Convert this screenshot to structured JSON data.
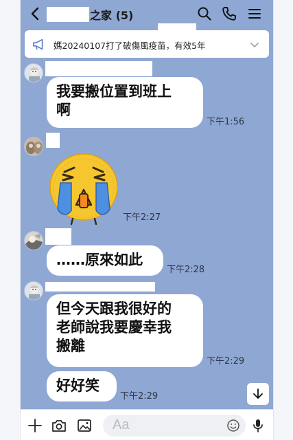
{
  "header": {
    "title_suffix": "之家",
    "member_count": "(5)"
  },
  "announcement": {
    "text": "媽20240107打了破傷風疫苗，有效5年"
  },
  "messages": [
    {
      "text": "我要搬位置到班上\n啊",
      "time": "下午1:56"
    },
    {
      "sticker": "crying-face-sticker",
      "time": "下午2:27"
    },
    {
      "text": "……原來如此",
      "time": "下午2:28"
    },
    {
      "text": "但今天跟我很好的\n老師說我要慶幸我\n搬離",
      "time": "下午2:29"
    },
    {
      "text": "好好笑",
      "time": "下午2:29"
    }
  ],
  "footer": {
    "input_placeholder": "Aa"
  },
  "colors": {
    "chat_background": "#8fa7d3",
    "bubble": "#ffffff",
    "sticker_face": "#f6c62e",
    "sticker_tears": "#4d8fe0"
  }
}
